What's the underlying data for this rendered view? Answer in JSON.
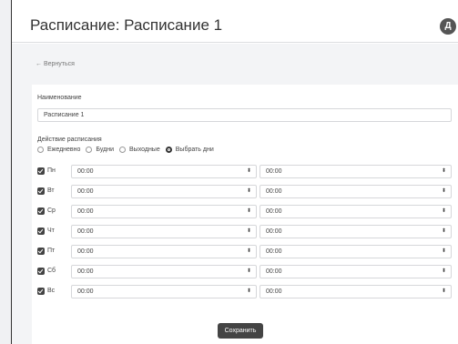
{
  "header": {
    "title": "Расписание: Расписание 1",
    "avatar_letter": "Д"
  },
  "nav": {
    "back_label": "← Вернуться"
  },
  "form": {
    "name_label": "Наименование",
    "name_value": "Расписание 1",
    "action_label": "Действие расписания",
    "options": [
      {
        "label": "Ежедневно",
        "checked": false
      },
      {
        "label": "Будни",
        "checked": false
      },
      {
        "label": "Выходные",
        "checked": false
      },
      {
        "label": "Выбрать дни",
        "checked": true
      }
    ],
    "days": [
      {
        "label": "Пн",
        "checked": true,
        "from": "00:00",
        "to": "00:00"
      },
      {
        "label": "Вт",
        "checked": true,
        "from": "00:00",
        "to": "00:00"
      },
      {
        "label": "Ср",
        "checked": true,
        "from": "00:00",
        "to": "00:00"
      },
      {
        "label": "Чт",
        "checked": true,
        "from": "00:00",
        "to": "00:00"
      },
      {
        "label": "Пт",
        "checked": true,
        "from": "00:00",
        "to": "00:00"
      },
      {
        "label": "Сб",
        "checked": true,
        "from": "00:00",
        "to": "00:00"
      },
      {
        "label": "Вс",
        "checked": true,
        "from": "00:00",
        "to": "00:00"
      }
    ],
    "caret": "⬍",
    "save_label": "Сохранить"
  }
}
